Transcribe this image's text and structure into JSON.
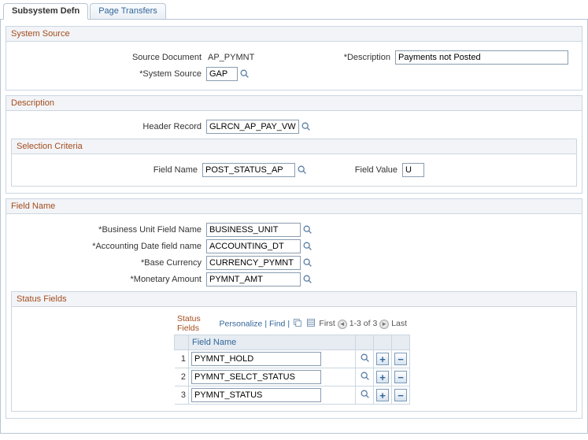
{
  "tabs": {
    "active": "Subsystem Defn",
    "inactive_1": "Page Transfers"
  },
  "sections": {
    "system_source": {
      "title": "System Source",
      "source_doc_label": "Source Document",
      "source_doc_value": "AP_PYMNT",
      "description_label": "Description",
      "description_value": "Payments not Posted",
      "system_source_label": "System Source",
      "system_source_value": "GAP"
    },
    "description": {
      "title": "Description",
      "header_record_label": "Header Record",
      "header_record_value": "GLRCN_AP_PAY_VW"
    },
    "selection_criteria": {
      "title": "Selection Criteria",
      "field_name_label": "Field Name",
      "field_name_value": "POST_STATUS_AP",
      "field_value_label": "Field Value",
      "field_value_value": "U"
    },
    "field_name": {
      "title": "Field Name",
      "bu_label": "Business Unit Field Name",
      "bu_value": "BUSINESS_UNIT",
      "acctdate_label": "Accounting Date field name",
      "acctdate_value": "ACCOUNTING_DT",
      "basecur_label": "Base Currency",
      "basecur_value": "CURRENCY_PYMNT",
      "monamt_label": "Monetary Amount",
      "monamt_value": "PYMNT_AMT"
    },
    "status_fields": {
      "title": "Status Fields",
      "grid_title": "Status Fields",
      "personalize": "Personalize",
      "find": "Find",
      "first": "First",
      "last": "Last",
      "range": "1-3 of 3",
      "col_fieldname": "Field Name",
      "rows": [
        {
          "idx": "1",
          "name": "PYMNT_HOLD"
        },
        {
          "idx": "2",
          "name": "PYMNT_SELCT_STATUS"
        },
        {
          "idx": "3",
          "name": "PYMNT_STATUS"
        }
      ]
    }
  }
}
